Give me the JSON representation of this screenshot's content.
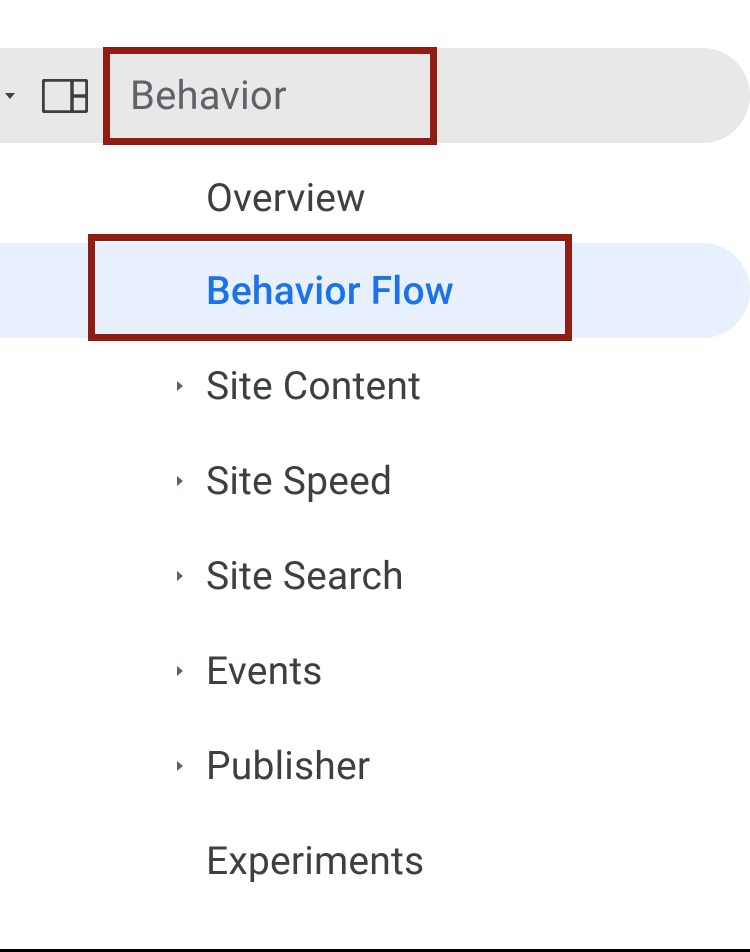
{
  "section": {
    "label": "Behavior"
  },
  "submenu": [
    {
      "id": "overview",
      "label": "Overview",
      "expandable": false,
      "active": false
    },
    {
      "id": "behavior-flow",
      "label": "Behavior Flow",
      "expandable": false,
      "active": true
    },
    {
      "id": "site-content",
      "label": "Site Content",
      "expandable": true,
      "active": false
    },
    {
      "id": "site-speed",
      "label": "Site Speed",
      "expandable": true,
      "active": false
    },
    {
      "id": "site-search",
      "label": "Site Search",
      "expandable": true,
      "active": false
    },
    {
      "id": "events",
      "label": "Events",
      "expandable": true,
      "active": false
    },
    {
      "id": "publisher",
      "label": "Publisher",
      "expandable": true,
      "active": false
    },
    {
      "id": "experiments",
      "label": "Experiments",
      "expandable": false,
      "active": false
    }
  ],
  "highlights": {
    "section": true,
    "active_item": true
  }
}
